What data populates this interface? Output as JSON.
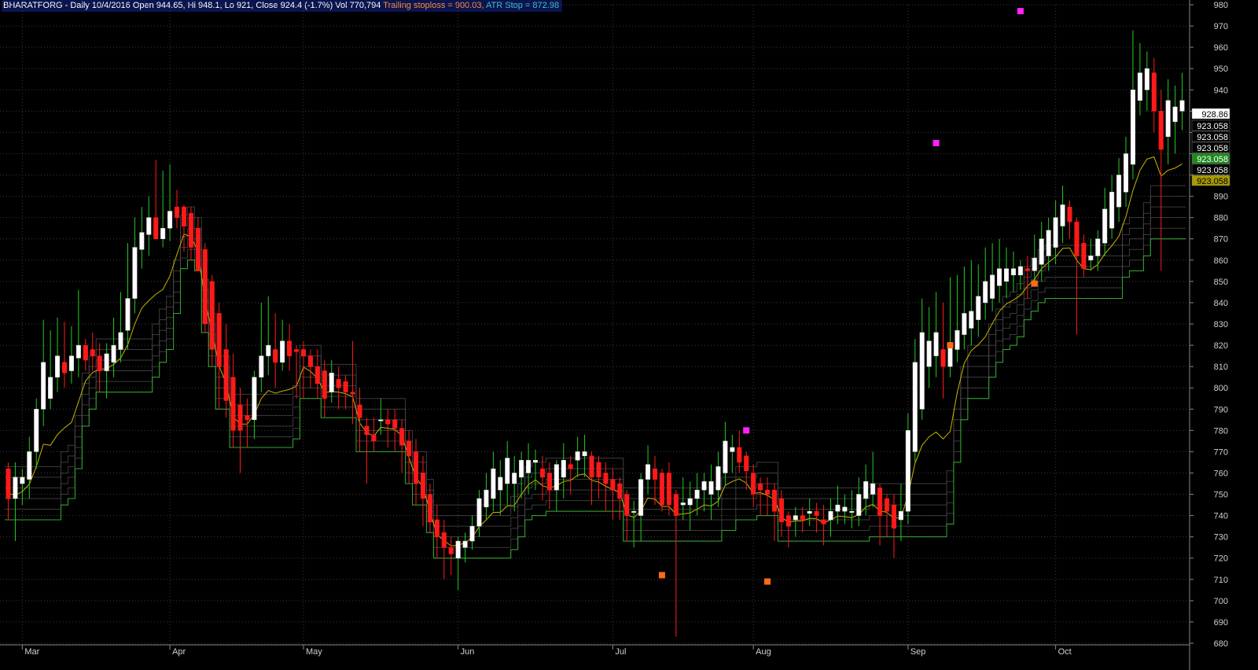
{
  "header": {
    "symbol_info": "BHARATFORG - Daily 10/4/2016 Open 944.65, Hi 948.1, Lo 921, Close 924.4 (-1.7%) Vol 770,794",
    "trailing_label": "Trailing stoploss = 900.03,",
    "atr_label": "ATR Stop = 872.98"
  },
  "colors": {
    "background": "#000000",
    "grid": "#3a3a3a",
    "bull_candle": "#ffffff",
    "bear_candle": "#ff1a1a",
    "bull_wick": "#22cc22",
    "stop_line": "#2fa82f",
    "trailing_line": "#c8b400",
    "buy_marker": "#ff22ff",
    "sell_marker": "#ff6a1a",
    "axis_text": "#d0d0d0"
  },
  "price_tags": [
    {
      "label": "928.86",
      "value": 928.86,
      "bg": "#ffffff",
      "fg": "#000000"
    },
    {
      "label": "923.058",
      "bg": "#000000",
      "fg": "#ffffff"
    },
    {
      "label": "923.058",
      "bg": "#000000",
      "fg": "#ffffff"
    },
    {
      "label": "923.058",
      "bg": "#000000",
      "fg": "#ffffff"
    },
    {
      "label": "923.058",
      "bg": "#1e8a1e",
      "fg": "#ffffff"
    },
    {
      "label": "923.058",
      "bg": "#000000",
      "fg": "#ffffff"
    },
    {
      "label": "923.058",
      "bg": "#a89a00",
      "fg": "#000000"
    }
  ],
  "chart_data": {
    "type": "candlestick",
    "y_axis": {
      "min": 680,
      "max": 980,
      "ticks": [
        680,
        690,
        700,
        710,
        720,
        730,
        740,
        750,
        760,
        770,
        780,
        790,
        800,
        810,
        820,
        830,
        840,
        850,
        860,
        870,
        880,
        890,
        900,
        910,
        920,
        930,
        940,
        950,
        960,
        970,
        980
      ]
    },
    "x_labels": [
      {
        "label": "Mar",
        "index": 2
      },
      {
        "label": "Apr",
        "index": 23
      },
      {
        "label": "May",
        "index": 42
      },
      {
        "label": "Jun",
        "index": 64
      },
      {
        "label": "Jul",
        "index": 86
      },
      {
        "label": "Aug",
        "index": 106
      },
      {
        "label": "Sep",
        "index": 128
      },
      {
        "label": "Oct",
        "index": 149
      }
    ],
    "candles": [
      {
        "o": 762,
        "h": 765,
        "l": 738,
        "c": 748
      },
      {
        "o": 748,
        "h": 765,
        "l": 728,
        "c": 758
      },
      {
        "o": 755,
        "h": 762,
        "l": 745,
        "c": 758
      },
      {
        "o": 757,
        "h": 777,
        "l": 748,
        "c": 770
      },
      {
        "o": 770,
        "h": 795,
        "l": 762,
        "c": 790
      },
      {
        "o": 790,
        "h": 832,
        "l": 782,
        "c": 812
      },
      {
        "o": 795,
        "h": 827,
        "l": 790,
        "c": 805
      },
      {
        "o": 805,
        "h": 833,
        "l": 798,
        "c": 815
      },
      {
        "o": 812,
        "h": 831,
        "l": 800,
        "c": 807
      },
      {
        "o": 808,
        "h": 829,
        "l": 802,
        "c": 815
      },
      {
        "o": 814,
        "h": 846,
        "l": 805,
        "c": 820
      },
      {
        "o": 820,
        "h": 823,
        "l": 808,
        "c": 813
      },
      {
        "o": 818,
        "h": 826,
        "l": 808,
        "c": 815
      },
      {
        "o": 815,
        "h": 821,
        "l": 798,
        "c": 808
      },
      {
        "o": 808,
        "h": 821,
        "l": 795,
        "c": 816
      },
      {
        "o": 812,
        "h": 833,
        "l": 805,
        "c": 820
      },
      {
        "o": 818,
        "h": 845,
        "l": 812,
        "c": 826
      },
      {
        "o": 827,
        "h": 868,
        "l": 818,
        "c": 842
      },
      {
        "o": 842,
        "h": 880,
        "l": 835,
        "c": 866
      },
      {
        "o": 865,
        "h": 885,
        "l": 856,
        "c": 873
      },
      {
        "o": 872,
        "h": 890,
        "l": 862,
        "c": 880
      },
      {
        "o": 880,
        "h": 907,
        "l": 870,
        "c": 870
      },
      {
        "o": 870,
        "h": 902,
        "l": 866,
        "c": 875
      },
      {
        "o": 875,
        "h": 905,
        "l": 869,
        "c": 883
      },
      {
        "o": 885,
        "h": 893,
        "l": 875,
        "c": 880
      },
      {
        "o": 885,
        "h": 886,
        "l": 864,
        "c": 876
      },
      {
        "o": 882,
        "h": 885,
        "l": 860,
        "c": 866
      },
      {
        "o": 875,
        "h": 880,
        "l": 855,
        "c": 855
      },
      {
        "o": 865,
        "h": 868,
        "l": 826,
        "c": 830
      },
      {
        "o": 850,
        "h": 853,
        "l": 810,
        "c": 818
      },
      {
        "o": 835,
        "h": 840,
        "l": 790,
        "c": 810
      },
      {
        "o": 818,
        "h": 830,
        "l": 786,
        "c": 794
      },
      {
        "o": 805,
        "h": 816,
        "l": 772,
        "c": 780
      },
      {
        "o": 792,
        "h": 800,
        "l": 760,
        "c": 780
      },
      {
        "o": 787,
        "h": 795,
        "l": 772,
        "c": 785
      },
      {
        "o": 785,
        "h": 808,
        "l": 776,
        "c": 805
      },
      {
        "o": 805,
        "h": 840,
        "l": 798,
        "c": 815
      },
      {
        "o": 815,
        "h": 843,
        "l": 806,
        "c": 820
      },
      {
        "o": 818,
        "h": 835,
        "l": 800,
        "c": 812
      },
      {
        "o": 812,
        "h": 832,
        "l": 808,
        "c": 822
      },
      {
        "o": 822,
        "h": 830,
        "l": 808,
        "c": 815
      },
      {
        "o": 818,
        "h": 820,
        "l": 795,
        "c": 817
      },
      {
        "o": 818,
        "h": 822,
        "l": 795,
        "c": 815
      },
      {
        "o": 815,
        "h": 818,
        "l": 800,
        "c": 810
      },
      {
        "o": 810,
        "h": 818,
        "l": 795,
        "c": 802
      },
      {
        "o": 808,
        "h": 813,
        "l": 786,
        "c": 795
      },
      {
        "o": 798,
        "h": 813,
        "l": 793,
        "c": 807
      },
      {
        "o": 804,
        "h": 810,
        "l": 790,
        "c": 800
      },
      {
        "o": 803,
        "h": 806,
        "l": 790,
        "c": 798
      },
      {
        "o": 798,
        "h": 822,
        "l": 783,
        "c": 797
      },
      {
        "o": 792,
        "h": 800,
        "l": 770,
        "c": 786
      },
      {
        "o": 782,
        "h": 786,
        "l": 755,
        "c": 778
      },
      {
        "o": 778,
        "h": 786,
        "l": 770,
        "c": 775
      },
      {
        "o": 785,
        "h": 795,
        "l": 778,
        "c": 785
      },
      {
        "o": 785,
        "h": 790,
        "l": 772,
        "c": 783
      },
      {
        "o": 785,
        "h": 790,
        "l": 770,
        "c": 781
      },
      {
        "o": 781,
        "h": 785,
        "l": 760,
        "c": 773
      },
      {
        "o": 775,
        "h": 780,
        "l": 755,
        "c": 768
      },
      {
        "o": 770,
        "h": 776,
        "l": 745,
        "c": 755
      },
      {
        "o": 760,
        "h": 768,
        "l": 735,
        "c": 748
      },
      {
        "o": 750,
        "h": 755,
        "l": 732,
        "c": 737
      },
      {
        "o": 738,
        "h": 745,
        "l": 720,
        "c": 730
      },
      {
        "o": 732,
        "h": 738,
        "l": 710,
        "c": 725
      },
      {
        "o": 725,
        "h": 730,
        "l": 712,
        "c": 722
      },
      {
        "o": 720,
        "h": 730,
        "l": 705,
        "c": 728
      },
      {
        "o": 725,
        "h": 732,
        "l": 718,
        "c": 728
      }
    ],
    "candles_2": [
      {
        "o": 728,
        "h": 740,
        "l": 724,
        "c": 735
      },
      {
        "o": 735,
        "h": 752,
        "l": 730,
        "c": 748
      },
      {
        "o": 744,
        "h": 760,
        "l": 738,
        "c": 752
      },
      {
        "o": 748,
        "h": 770,
        "l": 742,
        "c": 762
      },
      {
        "o": 752,
        "h": 766,
        "l": 740,
        "c": 758
      },
      {
        "o": 755,
        "h": 775,
        "l": 745,
        "c": 767
      },
      {
        "o": 755,
        "h": 768,
        "l": 742,
        "c": 760
      },
      {
        "o": 758,
        "h": 770,
        "l": 748,
        "c": 766
      },
      {
        "o": 760,
        "h": 774,
        "l": 750,
        "c": 766
      },
      {
        "o": 765,
        "h": 771,
        "l": 752,
        "c": 766
      },
      {
        "o": 762,
        "h": 768,
        "l": 747,
        "c": 758
      },
      {
        "o": 760,
        "h": 765,
        "l": 743,
        "c": 752
      },
      {
        "o": 752,
        "h": 766,
        "l": 742,
        "c": 764
      },
      {
        "o": 758,
        "h": 774,
        "l": 748,
        "c": 766
      },
      {
        "o": 764,
        "h": 768,
        "l": 750,
        "c": 762
      },
      {
        "o": 766,
        "h": 777,
        "l": 758,
        "c": 770
      },
      {
        "o": 768,
        "h": 778,
        "l": 758,
        "c": 770
      },
      {
        "o": 768,
        "h": 770,
        "l": 745,
        "c": 758
      },
      {
        "o": 765,
        "h": 768,
        "l": 748,
        "c": 758
      },
      {
        "o": 760,
        "h": 765,
        "l": 742,
        "c": 755
      },
      {
        "o": 757,
        "h": 762,
        "l": 738,
        "c": 752
      },
      {
        "o": 755,
        "h": 758,
        "l": 738,
        "c": 748
      },
      {
        "o": 750,
        "h": 752,
        "l": 728,
        "c": 740
      },
      {
        "o": 742,
        "h": 747,
        "l": 725,
        "c": 742
      },
      {
        "o": 740,
        "h": 760,
        "l": 728,
        "c": 757
      },
      {
        "o": 757,
        "h": 773,
        "l": 750,
        "c": 764
      },
      {
        "o": 762,
        "h": 768,
        "l": 745,
        "c": 757
      },
      {
        "o": 760,
        "h": 762,
        "l": 742,
        "c": 745
      },
      {
        "o": 760,
        "h": 765,
        "l": 740,
        "c": 745
      },
      {
        "o": 750,
        "h": 752,
        "l": 683,
        "c": 740
      },
      {
        "o": 745,
        "h": 758,
        "l": 738,
        "c": 746
      },
      {
        "o": 745,
        "h": 756,
        "l": 733,
        "c": 748
      },
      {
        "o": 748,
        "h": 760,
        "l": 740,
        "c": 752
      },
      {
        "o": 752,
        "h": 760,
        "l": 742,
        "c": 756
      },
      {
        "o": 750,
        "h": 764,
        "l": 738,
        "c": 756
      },
      {
        "o": 752,
        "h": 770,
        "l": 744,
        "c": 763
      },
      {
        "o": 760,
        "h": 784,
        "l": 754,
        "c": 775
      },
      {
        "o": 770,
        "h": 778,
        "l": 760,
        "c": 772
      },
      {
        "o": 772,
        "h": 780,
        "l": 760,
        "c": 765
      },
      {
        "o": 768,
        "h": 770,
        "l": 752,
        "c": 761
      },
      {
        "o": 760,
        "h": 764,
        "l": 744,
        "c": 750
      },
      {
        "o": 755,
        "h": 758,
        "l": 740,
        "c": 752
      },
      {
        "o": 752,
        "h": 758,
        "l": 740,
        "c": 750
      },
      {
        "o": 752,
        "h": 755,
        "l": 728,
        "c": 742
      },
      {
        "o": 748,
        "h": 752,
        "l": 730,
        "c": 737
      },
      {
        "o": 740,
        "h": 742,
        "l": 725,
        "c": 735
      },
      {
        "o": 738,
        "h": 744,
        "l": 730,
        "c": 740
      },
      {
        "o": 740,
        "h": 744,
        "l": 732,
        "c": 738
      },
      {
        "o": 741,
        "h": 748,
        "l": 735,
        "c": 742
      },
      {
        "o": 742,
        "h": 746,
        "l": 732,
        "c": 740
      },
      {
        "o": 738,
        "h": 745,
        "l": 726,
        "c": 736
      },
      {
        "o": 738,
        "h": 748,
        "l": 730,
        "c": 742
      },
      {
        "o": 742,
        "h": 754,
        "l": 736,
        "c": 745
      },
      {
        "o": 742,
        "h": 750,
        "l": 736,
        "c": 744
      },
      {
        "o": 742,
        "h": 752,
        "l": 734,
        "c": 742
      },
      {
        "o": 740,
        "h": 758,
        "l": 735,
        "c": 750
      },
      {
        "o": 748,
        "h": 764,
        "l": 740,
        "c": 756
      },
      {
        "o": 750,
        "h": 770,
        "l": 744,
        "c": 755
      },
      {
        "o": 753,
        "h": 755,
        "l": 726,
        "c": 740
      },
      {
        "o": 748,
        "h": 750,
        "l": 730,
        "c": 742
      },
      {
        "o": 745,
        "h": 750,
        "l": 720,
        "c": 734
      }
    ],
    "candles_3": [
      {
        "o": 738,
        "h": 755,
        "l": 728,
        "c": 742
      },
      {
        "o": 742,
        "h": 788,
        "l": 736,
        "c": 780
      },
      {
        "o": 770,
        "h": 823,
        "l": 765,
        "c": 812
      },
      {
        "o": 790,
        "h": 842,
        "l": 785,
        "c": 826
      },
      {
        "o": 810,
        "h": 838,
        "l": 800,
        "c": 822
      },
      {
        "o": 815,
        "h": 845,
        "l": 805,
        "c": 826
      },
      {
        "o": 818,
        "h": 840,
        "l": 795,
        "c": 810
      },
      {
        "o": 810,
        "h": 852,
        "l": 805,
        "c": 820
      },
      {
        "o": 818,
        "h": 853,
        "l": 812,
        "c": 827
      },
      {
        "o": 825,
        "h": 857,
        "l": 818,
        "c": 835
      },
      {
        "o": 828,
        "h": 860,
        "l": 820,
        "c": 836
      },
      {
        "o": 832,
        "h": 858,
        "l": 824,
        "c": 843
      },
      {
        "o": 840,
        "h": 866,
        "l": 832,
        "c": 850
      },
      {
        "o": 842,
        "h": 868,
        "l": 836,
        "c": 853
      },
      {
        "o": 848,
        "h": 870,
        "l": 840,
        "c": 856
      },
      {
        "o": 850,
        "h": 866,
        "l": 842,
        "c": 856
      },
      {
        "o": 853,
        "h": 864,
        "l": 845,
        "c": 856
      },
      {
        "o": 853,
        "h": 860,
        "l": 846,
        "c": 857
      },
      {
        "o": 856,
        "h": 862,
        "l": 842,
        "c": 855
      },
      {
        "o": 855,
        "h": 872,
        "l": 848,
        "c": 861
      },
      {
        "o": 858,
        "h": 878,
        "l": 850,
        "c": 870
      },
      {
        "o": 862,
        "h": 880,
        "l": 855,
        "c": 874
      },
      {
        "o": 866,
        "h": 888,
        "l": 858,
        "c": 880
      },
      {
        "o": 876,
        "h": 895,
        "l": 868,
        "c": 886
      },
      {
        "o": 885,
        "h": 888,
        "l": 870,
        "c": 878
      },
      {
        "o": 878,
        "h": 880,
        "l": 825,
        "c": 862
      },
      {
        "o": 868,
        "h": 872,
        "l": 852,
        "c": 856
      },
      {
        "o": 860,
        "h": 870,
        "l": 855,
        "c": 862
      },
      {
        "o": 862,
        "h": 874,
        "l": 855,
        "c": 870
      },
      {
        "o": 868,
        "h": 894,
        "l": 862,
        "c": 884
      },
      {
        "o": 875,
        "h": 900,
        "l": 870,
        "c": 892
      },
      {
        "o": 885,
        "h": 908,
        "l": 878,
        "c": 900
      },
      {
        "o": 892,
        "h": 918,
        "l": 885,
        "c": 910
      },
      {
        "o": 905,
        "h": 968,
        "l": 898,
        "c": 940
      },
      {
        "o": 935,
        "h": 962,
        "l": 928,
        "c": 948
      },
      {
        "o": 940,
        "h": 958,
        "l": 930,
        "c": 950
      },
      {
        "o": 948,
        "h": 955,
        "l": 920,
        "c": 930
      },
      {
        "o": 930,
        "h": 940,
        "l": 855,
        "c": 912
      },
      {
        "o": 918,
        "h": 945,
        "l": 905,
        "c": 935
      },
      {
        "o": 925,
        "h": 942,
        "l": 910,
        "c": 932
      },
      {
        "o": 930,
        "h": 948,
        "l": 921,
        "c": 935
      }
    ],
    "markers": [
      {
        "type": "buy",
        "index": 144,
        "price": 977
      },
      {
        "type": "buy",
        "index": 132,
        "price": 915
      },
      {
        "type": "buy",
        "index": 105,
        "price": 780
      },
      {
        "type": "sell",
        "index": 93,
        "price": 712
      },
      {
        "type": "sell",
        "index": 108,
        "price": 709
      },
      {
        "type": "sell",
        "index": 134,
        "price": 820
      },
      {
        "type": "sell",
        "index": 146,
        "price": 849
      }
    ]
  }
}
